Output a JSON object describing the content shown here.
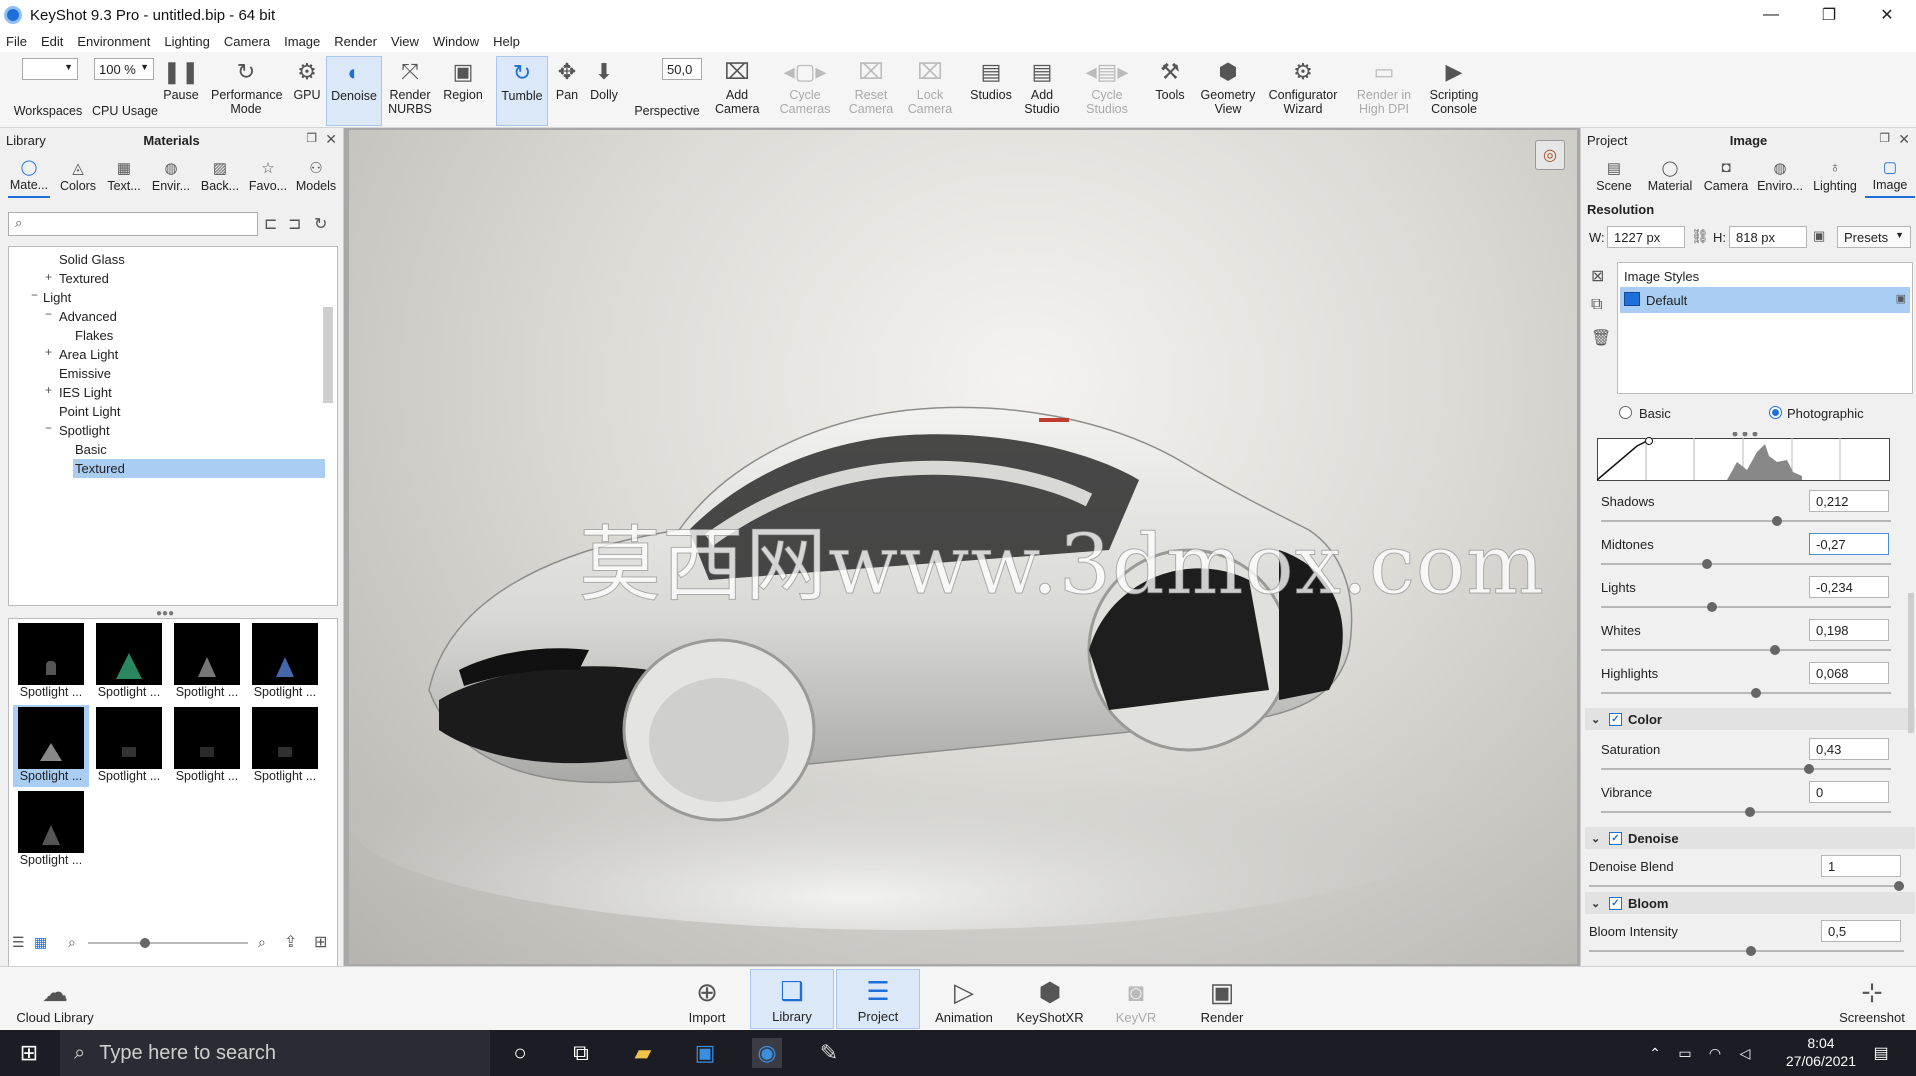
{
  "window": {
    "title": "KeyShot 9.3 Pro  - untitled.bip  - 64 bit",
    "minimize": "—",
    "maximize": "❐",
    "close": "✕"
  },
  "menu": [
    "File",
    "Edit",
    "Environment",
    "Lighting",
    "Camera",
    "Image",
    "Render",
    "View",
    "Window",
    "Help"
  ],
  "toolbar": {
    "zoom_value": "100 %",
    "fov_value": "50,0",
    "buttons": [
      "Workspaces",
      "CPU Usage",
      "Pause",
      "Performance Mode",
      "GPU",
      "Denoise",
      "Render NURBS",
      "Region",
      "Tumble",
      "Pan",
      "Dolly",
      "Perspective",
      "Add Camera",
      "Cycle Cameras",
      "Reset Camera",
      "Lock Camera",
      "Studios",
      "Add Studio",
      "Cycle Studios",
      "Tools",
      "Geometry View",
      "Configurator Wizard",
      "Render in High DPI",
      "Scripting Console"
    ]
  },
  "library": {
    "left_title": "Library",
    "center_title": "Materials",
    "tabs": [
      "Mate...",
      "Colors",
      "Text...",
      "Envir...",
      "Back...",
      "Favo...",
      "Models"
    ],
    "tree": [
      "Solid Glass",
      "Textured",
      "Light",
      "Advanced",
      "Flakes",
      "Area Light",
      "Emissive",
      "IES Light",
      "Point Light",
      "Spotlight",
      "Basic",
      "Textured"
    ],
    "thumb_label": "Spotlight ..."
  },
  "viewport": {
    "watermark": "莫西网www.3dmox.com"
  },
  "project": {
    "left_title": "Project",
    "center_title": "Image",
    "tabs": [
      "Scene",
      "Material",
      "Camera",
      "Enviro...",
      "Lighting",
      "Image"
    ],
    "resolution_heading": "Resolution",
    "w_label": "W:",
    "w_value": "1227 px",
    "h_label": "H:",
    "h_value": "818 px",
    "presets": "Presets",
    "image_styles_header": "Image Styles",
    "style_default": "Default",
    "mode_basic": "Basic",
    "mode_photographic": "Photographic",
    "params": [
      {
        "label": "Shadows",
        "value": "0,212",
        "pos": 0.212
      },
      {
        "label": "Midtones",
        "value": "-0,27",
        "pos": -0.27
      },
      {
        "label": "Lights",
        "value": "-0,234",
        "pos": -0.234
      },
      {
        "label": "Whites",
        "value": "0,198",
        "pos": 0.198
      },
      {
        "label": "Highlights",
        "value": "0,068",
        "pos": 0.068
      }
    ],
    "color_section": "Color",
    "saturation_label": "Saturation",
    "saturation_value": "0,43",
    "vibrance_label": "Vibrance",
    "vibrance_value": "0",
    "denoise_section": "Denoise",
    "denoise_blend_label": "Denoise Blend",
    "denoise_blend_value": "1",
    "bloom_section": "Bloom",
    "bloom_intensity_label": "Bloom Intensity",
    "bloom_intensity_value": "0,5"
  },
  "bottom": {
    "cloud_library": "Cloud Library",
    "buttons": [
      "Import",
      "Library",
      "Project",
      "Animation",
      "KeyShotXR",
      "KeyVR",
      "Render"
    ],
    "screenshot": "Screenshot"
  },
  "taskbar": {
    "search_placeholder": "Type here to search",
    "time": "8:04",
    "date": "27/06/2021"
  },
  "colors": {
    "accent": "#1e6fd9",
    "selection": "#a9cdf3",
    "taskbar": "#1c1c24"
  }
}
